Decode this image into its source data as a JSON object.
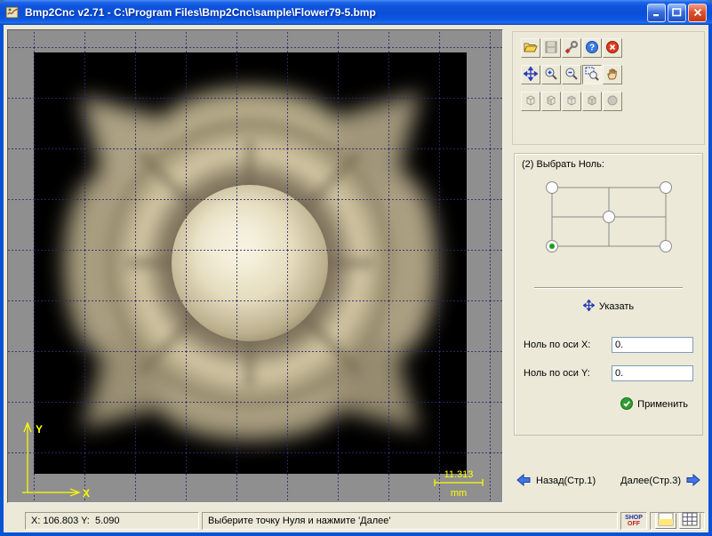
{
  "window": {
    "title": "Bmp2Cnc v2.71 - C:\\Program Files\\Bmp2Cnc\\sample\\Flower79-5.bmp"
  },
  "icons": {
    "help_glyph": "?"
  },
  "canvas": {
    "axis_x": "X",
    "axis_y": "Y",
    "scale_value": "11.313",
    "scale_unit": "mm"
  },
  "toolbars": {
    "file": [
      "open-file-icon",
      "save-file-icon",
      "options-icon",
      "help-icon",
      "exit-icon"
    ],
    "zoom": [
      "move-icon",
      "zoom-in-icon",
      "zoom-out-icon",
      "zoom-window-icon",
      "pan-hand-icon"
    ],
    "view3d": [
      "view-left-icon",
      "view-front-icon",
      "view-top-icon",
      "view-iso-icon",
      "view-render-icon"
    ]
  },
  "zero_panel": {
    "title": "(2) Выбрать Ноль:",
    "pick_label": "Указать",
    "x_label": "Ноль по оси X:",
    "x_value": "0.",
    "y_label": "Ноль по оси Y:",
    "y_value": "0.",
    "apply_label": "Применить",
    "selected_position": "bottom-left"
  },
  "nav": {
    "back_label": "Назад(Стр.1)",
    "next_label": "Далее(Стр.3)"
  },
  "statusbar": {
    "coords": "X: 106.803 Y:  5.090",
    "message": "Выберите точку Нуля и нажмите 'Далее'",
    "shop_top": "SHOP",
    "shop_bottom": "OFF"
  }
}
